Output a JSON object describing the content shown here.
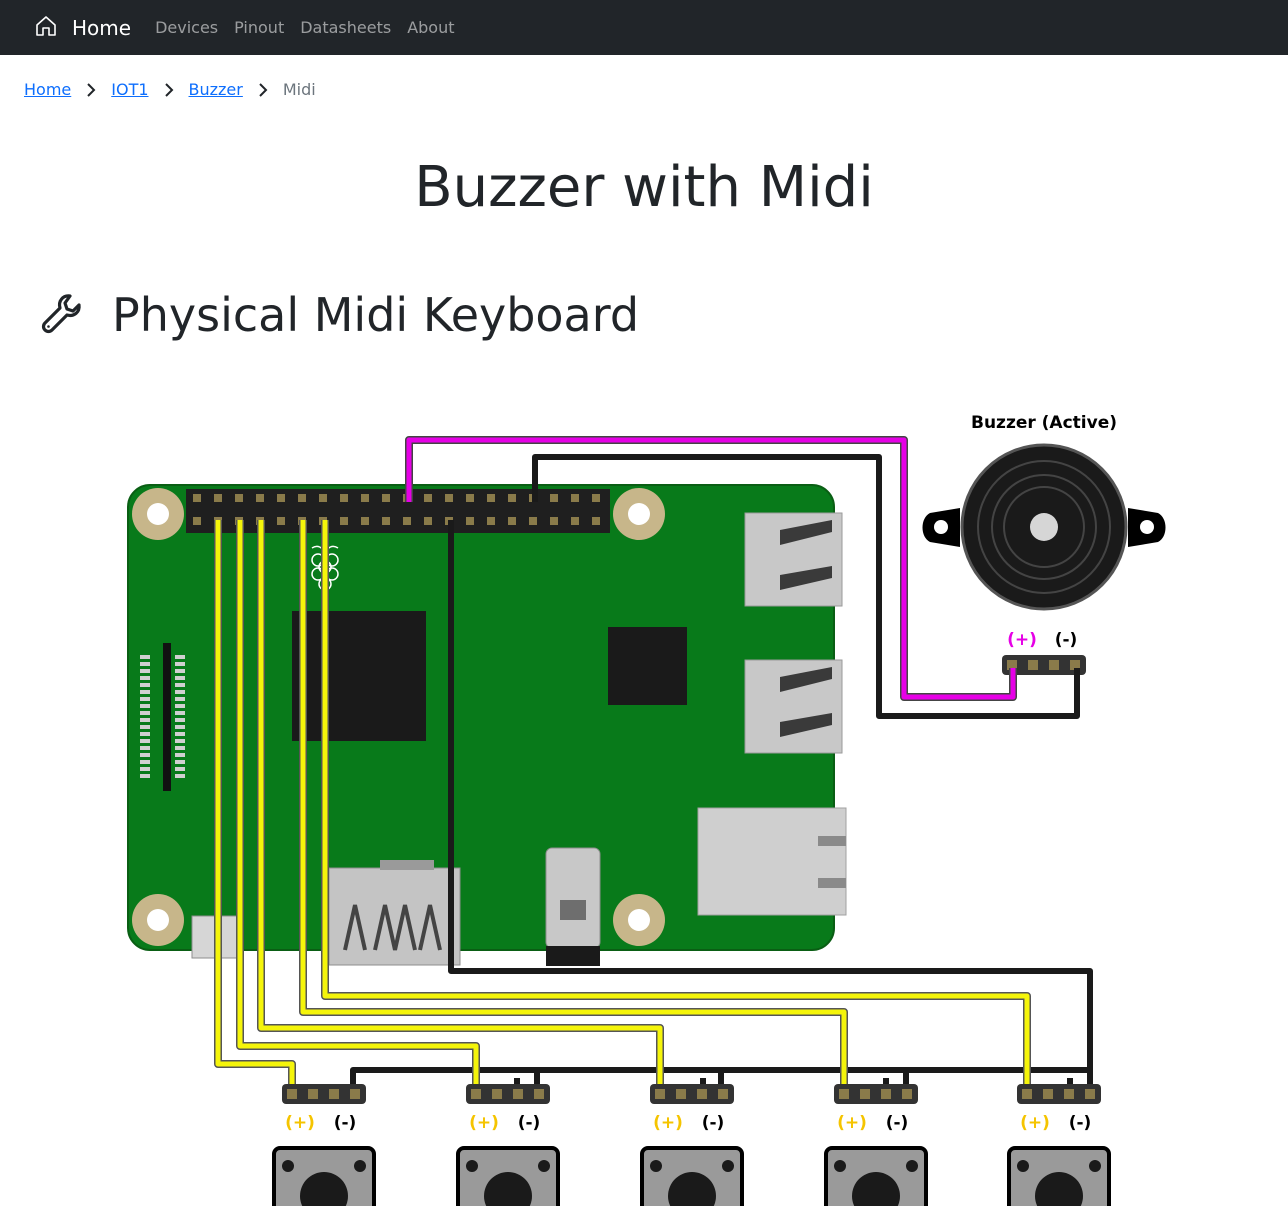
{
  "navbar": {
    "brand_icon": "house-icon",
    "brand_label": "Home",
    "links": [
      "Devices",
      "Pinout",
      "Datasheets",
      "About"
    ]
  },
  "breadcrumb": {
    "items": [
      "Home",
      "IOT1",
      "Buzzer"
    ],
    "active": "Midi",
    "separator_icon": "chevron-right-icon"
  },
  "page": {
    "title": "Buzzer with Midi"
  },
  "section": {
    "icon": "wrench-icon",
    "title": "Physical Midi Keyboard"
  },
  "diagram": {
    "buzzer_label": "Buzzer (Active)",
    "plus_label": "(+)",
    "minus_label": "(-)",
    "button_count": 5,
    "colors": {
      "board": "#087a1a",
      "signal_wire": "#f5f50a",
      "buzzer_wire": "#e600e6",
      "ground_wire": "#1a1a1a",
      "plus_label": "#f5c400",
      "buzzer_plus_label": "#e600e6",
      "navbar": "#212529",
      "link": "#0d6efd"
    }
  }
}
